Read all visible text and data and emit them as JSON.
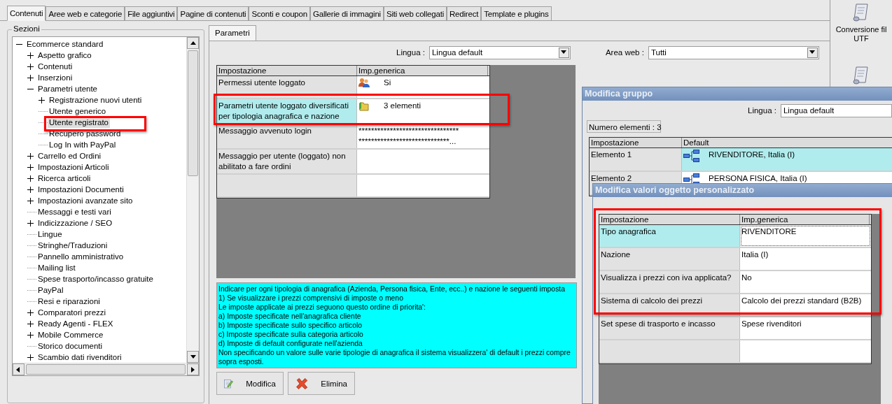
{
  "tabs": [
    {
      "label": "Contenuti",
      "selected": true
    },
    {
      "label": "Aree web e categorie",
      "selected": false
    },
    {
      "label": "File aggiuntivi",
      "selected": false
    },
    {
      "label": "Pagine di contenuti",
      "selected": false
    },
    {
      "label": "Sconti e coupon",
      "selected": false
    },
    {
      "label": "Gallerie di immagini",
      "selected": false
    },
    {
      "label": "Siti web collegati",
      "selected": false
    },
    {
      "label": "Redirect",
      "selected": false
    },
    {
      "label": "Template e plugins",
      "selected": false
    }
  ],
  "sections": {
    "title": "Sezioni",
    "tree": [
      {
        "label": "Ecommerce standard",
        "expanded": true,
        "selected": false,
        "children": [
          {
            "label": "Aspetto grafico",
            "expanded": false,
            "selected": false
          },
          {
            "label": "Contenuti",
            "expanded": false,
            "selected": false
          },
          {
            "label": "Inserzioni",
            "expanded": false,
            "selected": false
          },
          {
            "label": "Parametri utente",
            "expanded": true,
            "selected": false,
            "children": [
              {
                "label": "Registrazione nuovi utenti",
                "expanded": false,
                "selected": false
              },
              {
                "label": "Utente generico",
                "selected": false
              },
              {
                "label": "Utente registrato",
                "selected": true
              },
              {
                "label": "Recupero password",
                "selected": false
              },
              {
                "label": "Log In with PayPal",
                "selected": false
              }
            ]
          },
          {
            "label": "Carrello ed Ordini",
            "expanded": false,
            "selected": false
          },
          {
            "label": "Impostazioni Articoli",
            "expanded": false,
            "selected": false
          },
          {
            "label": "Ricerca articoli",
            "expanded": false,
            "selected": false
          },
          {
            "label": "Impostazioni Documenti",
            "expanded": false,
            "selected": false
          },
          {
            "label": "Impostazioni avanzate sito",
            "expanded": false,
            "selected": false
          },
          {
            "label": "Messaggi e testi vari",
            "selected": false
          },
          {
            "label": "Indicizzazione / SEO",
            "expanded": false,
            "selected": false
          },
          {
            "label": "Lingue",
            "selected": false
          },
          {
            "label": "Stringhe/Traduzioni",
            "selected": false
          },
          {
            "label": "Pannello amministrativo",
            "selected": false
          },
          {
            "label": "Mailing list",
            "selected": false
          },
          {
            "label": "Spese trasporto/incasso gratuite",
            "selected": false
          },
          {
            "label": "PayPal",
            "selected": false
          },
          {
            "label": "Resi e riparazioni",
            "selected": false
          },
          {
            "label": "Comparatori prezzi",
            "expanded": false,
            "selected": false
          },
          {
            "label": "Ready Agenti - FLEX",
            "expanded": false,
            "selected": false
          },
          {
            "label": "Mobile Commerce",
            "expanded": false,
            "selected": false
          },
          {
            "label": "Storico documenti",
            "selected": false
          },
          {
            "label": "Scambio dati rivenditori",
            "expanded": false,
            "selected": false
          }
        ]
      }
    ]
  },
  "parameters": {
    "tab": {
      "label": "Parametri",
      "selected": true
    },
    "language": {
      "label": "Lingua :",
      "value": "Lingua default"
    },
    "web_area": {
      "label": "Area web :",
      "value": "Tutti"
    },
    "grid": {
      "columns": [
        "Impostazione",
        "Imp.generica"
      ],
      "rows": [
        {
          "setting": "Permessi utente loggato",
          "kind": "users",
          "value": [
            "Si"
          ],
          "selected": false
        },
        {
          "setting": "Parametri utente loggato diversificati per tipologia anagrafica e nazione",
          "kind": "folder",
          "value": [
            "3 elementi"
          ],
          "selected": true
        },
        {
          "setting": "Messaggio avvenuto login",
          "value": [
            "********************************",
            "*****************************..."
          ],
          "selected": false
        },
        {
          "setting": "Messaggio per utente (loggato) non abilitato a fare ordini",
          "value": [],
          "selected": false
        },
        {
          "setting": "",
          "value": [],
          "selected": false
        }
      ]
    },
    "description": [
      "Indicare per ogni tipologia di anagrafica (Azienda, Persona fisica, Ente, ecc..) e nazione le seguenti imposta",
      "1) Se visualizzare i prezzi comprensivi di imposte o meno",
      "Le imposte applicate ai prezzi seguono questo ordine di priorita':",
      "a) Imposte specificate nell'anagrafica cliente",
      "b) Imposte specificate sullo specifico articolo",
      "c) Imposte specificate sulla categoria articolo",
      "d) Imposte di default configurate nell'azienda",
      "Non specificando un valore sulle varie tipologie di anagrafica il sistema visualizzera' di default i prezzi compre",
      "sopra esposti."
    ],
    "buttons": [
      {
        "label": "Modifica",
        "kind": "edit"
      },
      {
        "label": "Elimina",
        "kind": "delete"
      }
    ]
  },
  "group_dialog": {
    "title": "Modifica gruppo",
    "language": {
      "label": "Lingua :",
      "value": "Lingua default"
    },
    "count": "Numero elementi : 3",
    "grid": {
      "columns": [
        "Impostazione",
        "Default"
      ],
      "rows": [
        {
          "setting": "Elemento 1",
          "kind": "tree",
          "value": [
            "RIVENDITORE, Italia (I)"
          ],
          "selected": true
        },
        {
          "setting": "Elemento 2",
          "kind": "tree",
          "value": [
            "PERSONA FISICA, Italia (I)"
          ],
          "selected": false
        }
      ]
    }
  },
  "object_dialog": {
    "title": "Modifica valori oggetto personalizzato",
    "grid": {
      "columns": [
        "Impostazione",
        "Imp.generica"
      ],
      "rows": [
        {
          "setting": "Tipo anagrafica",
          "value": [
            "RIVENDITORE"
          ],
          "selected": true
        },
        {
          "setting": "Nazione",
          "value": [
            "Italia (I)"
          ],
          "selected": false
        },
        {
          "setting": "Visualizza i prezzi con iva applicata?",
          "value": [
            "No"
          ],
          "selected": false
        },
        {
          "setting": "Sistema di calcolo dei prezzi",
          "value": [
            "Calcolo dei prezzi standard (B2B)"
          ],
          "selected": false
        },
        {
          "setting": "Set spese di trasporto e incasso",
          "value": [
            "Spese rivenditori"
          ],
          "selected": false
        },
        {
          "setting": "",
          "value": [],
          "selected": false
        }
      ]
    }
  },
  "side_panel": {
    "tool_label": [
      "Conversione fil",
      "UTF"
    ]
  }
}
